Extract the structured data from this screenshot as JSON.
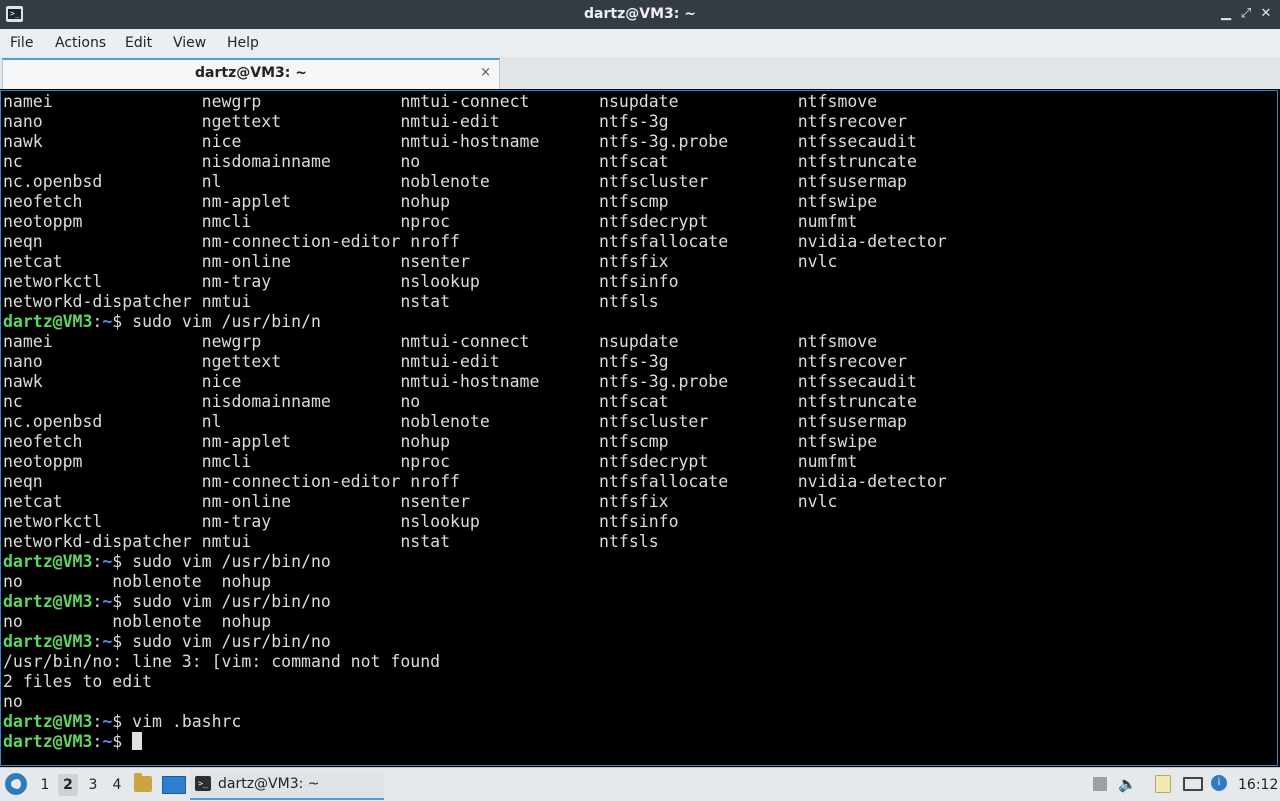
{
  "window": {
    "title": "dartz@VM3: ~",
    "app_icon": "terminal-icon",
    "controls": {
      "minimize": "▁",
      "maximize": "⤢",
      "close": "✕"
    }
  },
  "menu": [
    "File",
    "Actions",
    "Edit",
    "View",
    "Help"
  ],
  "tab": {
    "label": "dartz@VM3: ~",
    "close": "×"
  },
  "terminal": {
    "lines": [
      "namei               newgrp              nmtui-connect       nsupdate            ntfsmove",
      "nano                ngettext            nmtui-edit          ntfs-3g             ntfsrecover",
      "nawk                nice                nmtui-hostname      ntfs-3g.probe       ntfssecaudit",
      "nc                  nisdomainname       no                  ntfscat             ntfstruncate",
      "nc.openbsd          nl                  noblenote           ntfscluster         ntfsusermap",
      "neofetch            nm-applet           nohup               ntfscmp             ntfswipe",
      "neotoppm            nmcli               nproc               ntfsdecrypt         numfmt",
      "neqn                nm-connection-editor nroff              ntfsfallocate       nvidia-detector",
      "netcat              nm-online           nsenter             ntfsfix             nvlc",
      "networkctl          nm-tray             nslookup            ntfsinfo",
      "networkd-dispatcher nmtui               nstat               ntfsls",
      {
        "user": "dartz@VM3",
        "path": "~",
        "cmd": "$ sudo vim /usr/bin/n"
      },
      "namei               newgrp              nmtui-connect       nsupdate            ntfsmove",
      "nano                ngettext            nmtui-edit          ntfs-3g             ntfsrecover",
      "nawk                nice                nmtui-hostname      ntfs-3g.probe       ntfssecaudit",
      "nc                  nisdomainname       no                  ntfscat             ntfstruncate",
      "nc.openbsd          nl                  noblenote           ntfscluster         ntfsusermap",
      "neofetch            nm-applet           nohup               ntfscmp             ntfswipe",
      "neotoppm            nmcli               nproc               ntfsdecrypt         numfmt",
      "neqn                nm-connection-editor nroff              ntfsfallocate       nvidia-detector",
      "netcat              nm-online           nsenter             ntfsfix             nvlc",
      "networkctl          nm-tray             nslookup            ntfsinfo",
      "networkd-dispatcher nmtui               nstat               ntfsls",
      {
        "user": "dartz@VM3",
        "path": "~",
        "cmd": "$ sudo vim /usr/bin/no"
      },
      "no         noblenote  nohup",
      {
        "user": "dartz@VM3",
        "path": "~",
        "cmd": "$ sudo vim /usr/bin/no"
      },
      "no         noblenote  nohup",
      {
        "user": "dartz@VM3",
        "path": "~",
        "cmd": "$ sudo vim /usr/bin/no"
      },
      "/usr/bin/no: line 3: [vim: command not found",
      "2 files to edit",
      "no",
      {
        "user": "dartz@VM3",
        "path": "~",
        "cmd": "$ vim .bashrc"
      },
      {
        "user": "dartz@VM3",
        "path": "~",
        "cmd": "$ ",
        "cursor": true
      }
    ]
  },
  "taskbar": {
    "start_icon": "lubuntu-logo-icon",
    "workspaces": [
      {
        "label": "1",
        "active": false
      },
      {
        "label": "2",
        "active": true
      },
      {
        "label": "3",
        "active": false
      },
      {
        "label": "4",
        "active": false
      }
    ],
    "task": {
      "label": "dartz@VM3: ~",
      "icon": "terminal-icon"
    },
    "volume_glyph": "🔈",
    "updates_glyph": "i",
    "clock": "16:12"
  }
}
